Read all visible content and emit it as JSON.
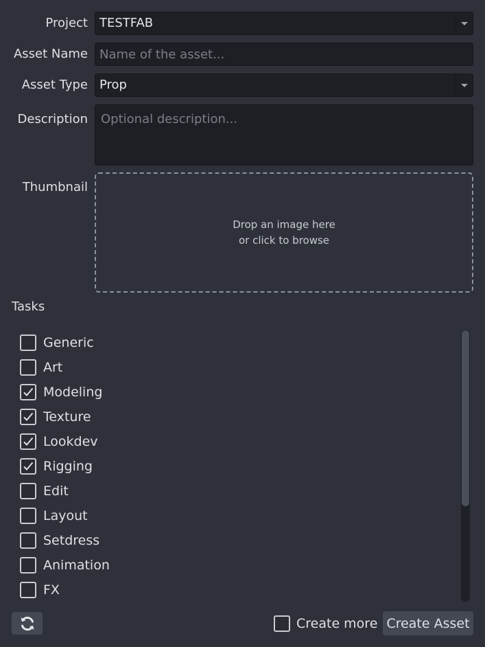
{
  "form": {
    "project": {
      "label": "Project",
      "value": "TESTFAB"
    },
    "asset_name": {
      "label": "Asset Name",
      "value": "",
      "placeholder": "Name of the asset..."
    },
    "asset_type": {
      "label": "Asset Type",
      "value": "Prop"
    },
    "description": {
      "label": "Description",
      "value": "",
      "placeholder": "Optional description..."
    },
    "thumbnail": {
      "label": "Thumbnail",
      "drop_line1": "Drop an image here",
      "drop_line2": "or click to browse"
    }
  },
  "tasks": {
    "title": "Tasks",
    "items": [
      {
        "label": "Generic",
        "checked": false
      },
      {
        "label": "Art",
        "checked": false
      },
      {
        "label": "Modeling",
        "checked": true
      },
      {
        "label": "Texture",
        "checked": true
      },
      {
        "label": "Lookdev",
        "checked": true
      },
      {
        "label": "Rigging",
        "checked": true
      },
      {
        "label": "Edit",
        "checked": false
      },
      {
        "label": "Layout",
        "checked": false
      },
      {
        "label": "Setdress",
        "checked": false
      },
      {
        "label": "Animation",
        "checked": false
      },
      {
        "label": "FX",
        "checked": false
      }
    ]
  },
  "footer": {
    "refresh_icon": "refresh-icon",
    "create_more": {
      "label": "Create more",
      "checked": false
    },
    "create_button": "Create Asset"
  },
  "colors": {
    "background": "#2f313a",
    "field_background": "#1d1f25",
    "button_background": "#444852",
    "text": "#dde0e4",
    "placeholder": "#7a7f88"
  }
}
